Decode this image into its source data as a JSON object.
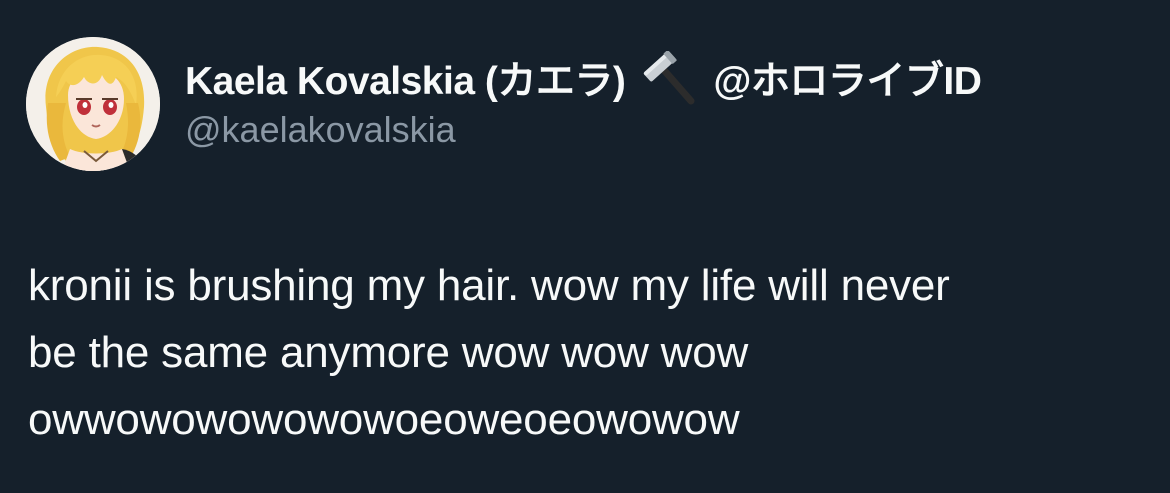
{
  "tweet": {
    "author": {
      "display_name": "Kaela Kovalskia (カエラ)",
      "emoji_icon": "hammer-icon",
      "affiliation": "@ホロライブID",
      "handle": "@kaelakovalskia"
    },
    "text_lines": [
      "kronii is brushing my hair. wow my life will never",
      "be the same anymore wow wow wow",
      "owwowowowowowoeoweoeowowow"
    ]
  },
  "theme": {
    "background": "#15202b",
    "text_primary": "#f7f9f9",
    "text_secondary": "#8b98a5"
  }
}
